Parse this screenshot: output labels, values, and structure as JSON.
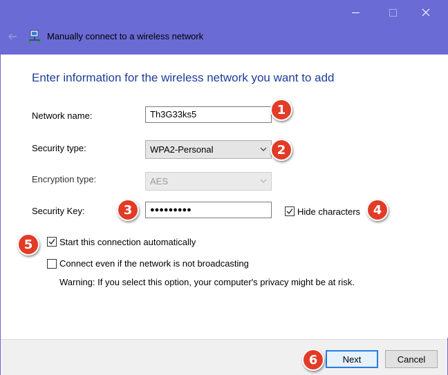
{
  "window": {
    "title": "Manually connect to a wireless network",
    "accent": "#6b6bd6"
  },
  "heading": "Enter information for the wireless network you want to add",
  "fields": {
    "network_name_label": "Network name:",
    "network_name_value": "Th3G33ks5",
    "security_type_label": "Security type:",
    "security_type_value": "WPA2-Personal",
    "encryption_type_label": "Encryption type:",
    "encryption_type_value": "AES",
    "security_key_label": "Security Key:",
    "security_key_value": "●●●●●●●●●"
  },
  "options": {
    "hide_characters": {
      "label": "Hide characters",
      "checked": true
    },
    "start_automatically": {
      "label": "Start this connection automatically",
      "checked": true
    },
    "connect_not_broadcasting": {
      "label": "Connect even if the network is not broadcasting",
      "checked": false
    },
    "warning": "Warning: If you select this option, your computer's privacy might be at risk."
  },
  "buttons": {
    "next": "Next",
    "cancel": "Cancel"
  },
  "markers": [
    "1",
    "2",
    "3",
    "4",
    "5",
    "6"
  ],
  "icons": {
    "back": "back-arrow-icon",
    "network": "network-icon",
    "minimize": "minimize-icon",
    "maximize": "maximize-icon",
    "close": "close-icon",
    "dropdown": "chevron-down-icon",
    "check": "checkmark-icon"
  },
  "colors": {
    "heading": "#1e3c9b",
    "marker": "#e23b26",
    "primary_button_border": "#2a7be4"
  }
}
